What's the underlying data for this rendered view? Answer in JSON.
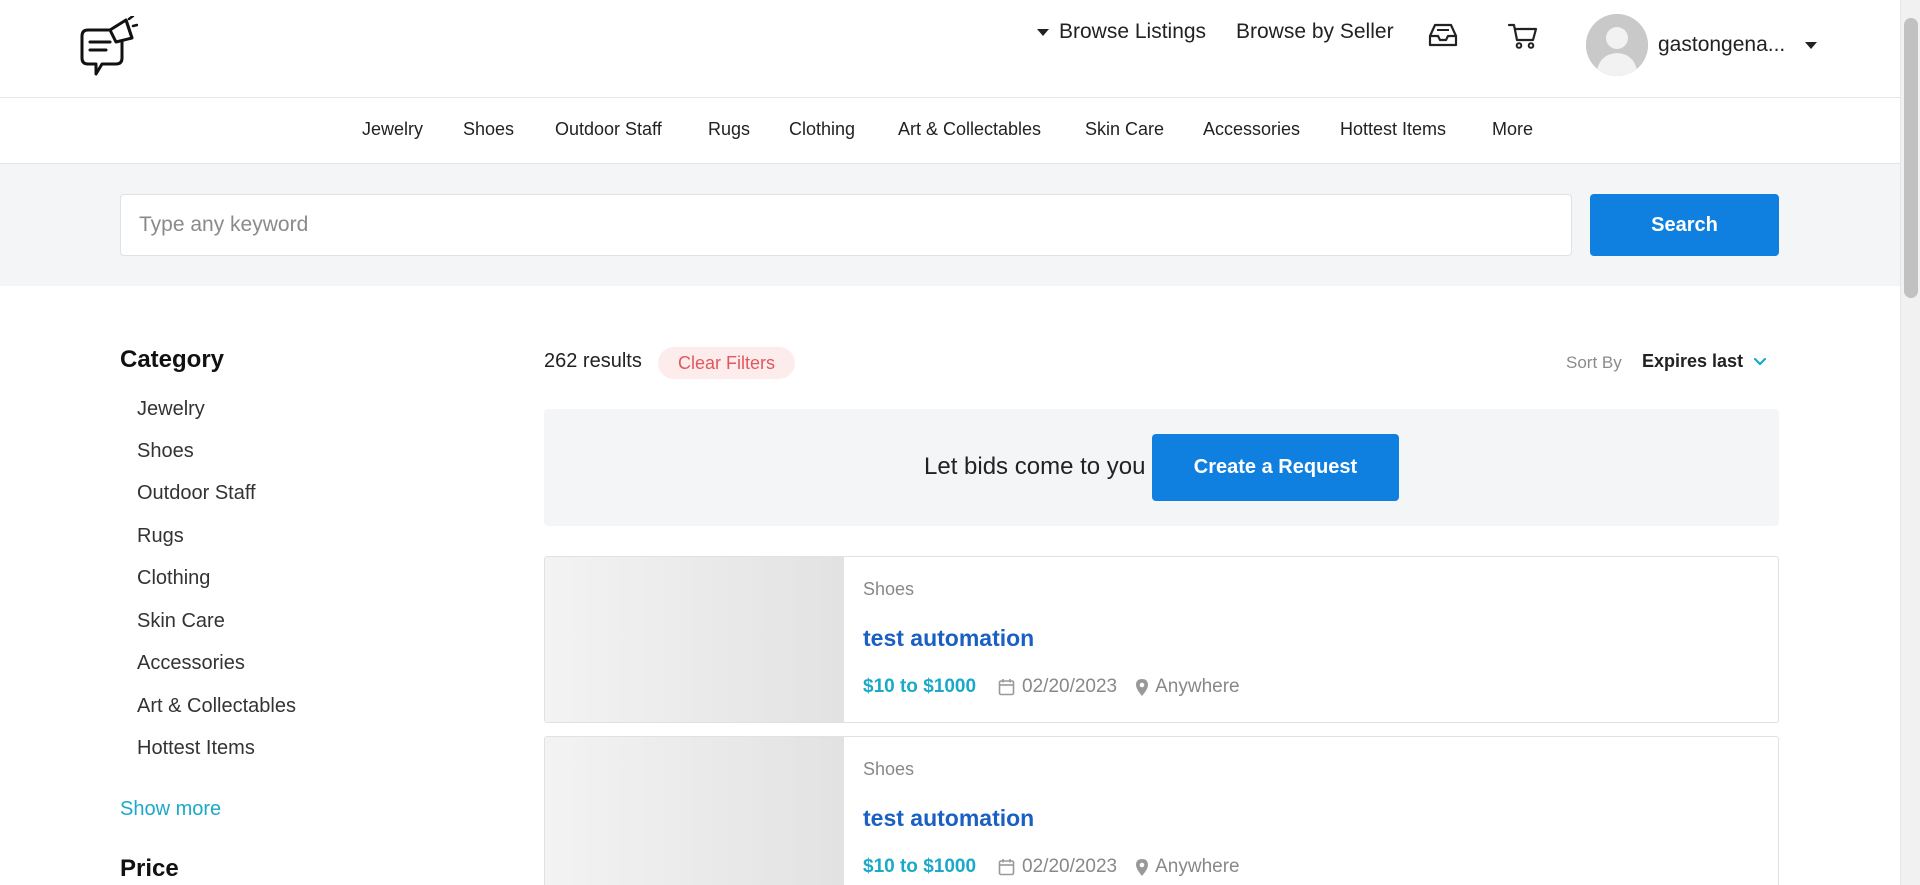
{
  "header": {
    "browse_listings": "Browse Listings",
    "browse_seller": "Browse by Seller",
    "username": "gastongena..."
  },
  "categories_nav": [
    "Jewelry",
    "Shoes",
    "Outdoor Staff",
    "Rugs",
    "Clothing",
    "Art & Collectables",
    "Skin Care",
    "Accessories",
    "Hottest Items",
    "More"
  ],
  "search": {
    "placeholder": "Type any keyword",
    "button_label": "Search"
  },
  "sidebar": {
    "category_title": "Category",
    "items": [
      "Jewelry",
      "Shoes",
      "Outdoor Staff",
      "Rugs",
      "Clothing",
      "Skin Care",
      "Accessories",
      "Art & Collectables",
      "Hottest Items"
    ],
    "show_more": "Show more",
    "price_title": "Price"
  },
  "results": {
    "count": "262 results",
    "clear_filters": "Clear Filters",
    "sort_label": "Sort By",
    "sort_value": "Expires last"
  },
  "request_banner": {
    "text": "Let bids come to you",
    "button_label": "Create a Request"
  },
  "listings": [
    {
      "category": "Shoes",
      "title": "test automation",
      "price": "$10 to $1000",
      "date": "02/20/2023",
      "location": "Anywhere"
    },
    {
      "category": "Shoes",
      "title": "test automation",
      "price": "$10 to $1000",
      "date": "02/20/2023",
      "location": "Anywhere"
    }
  ],
  "colors": {
    "accent": "#0f7fe0",
    "link_teal": "#1ba9c9",
    "title_blue": "#1a5fc4",
    "clear_filters_bg": "#fdecec",
    "clear_filters_text": "#e0585e"
  },
  "icons": [
    "logo-icon",
    "inbox-icon",
    "cart-icon",
    "avatar",
    "calendar-icon",
    "location-pin-icon",
    "chevron-down-icon"
  ]
}
